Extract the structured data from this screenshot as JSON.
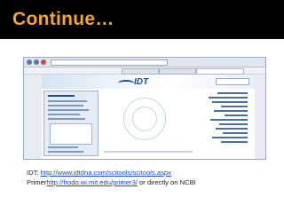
{
  "slide": {
    "title": "Continue…"
  },
  "caption": {
    "line1_label": "IDT: ",
    "line1_link": "http://www.idtdna.com/scitools/scitools.aspx",
    "line2_label": "Primer",
    "line2_link": "http://frodo.wi.mit.edu/primer3/",
    "line2_suffix": " or directly on NCBI"
  },
  "screenshot": {
    "logo_text": "IDT"
  },
  "colors": {
    "title": "#f5a623",
    "title_background": "#000000",
    "link": "#1a4dbd",
    "idt_blue": "#1f4f8f"
  }
}
